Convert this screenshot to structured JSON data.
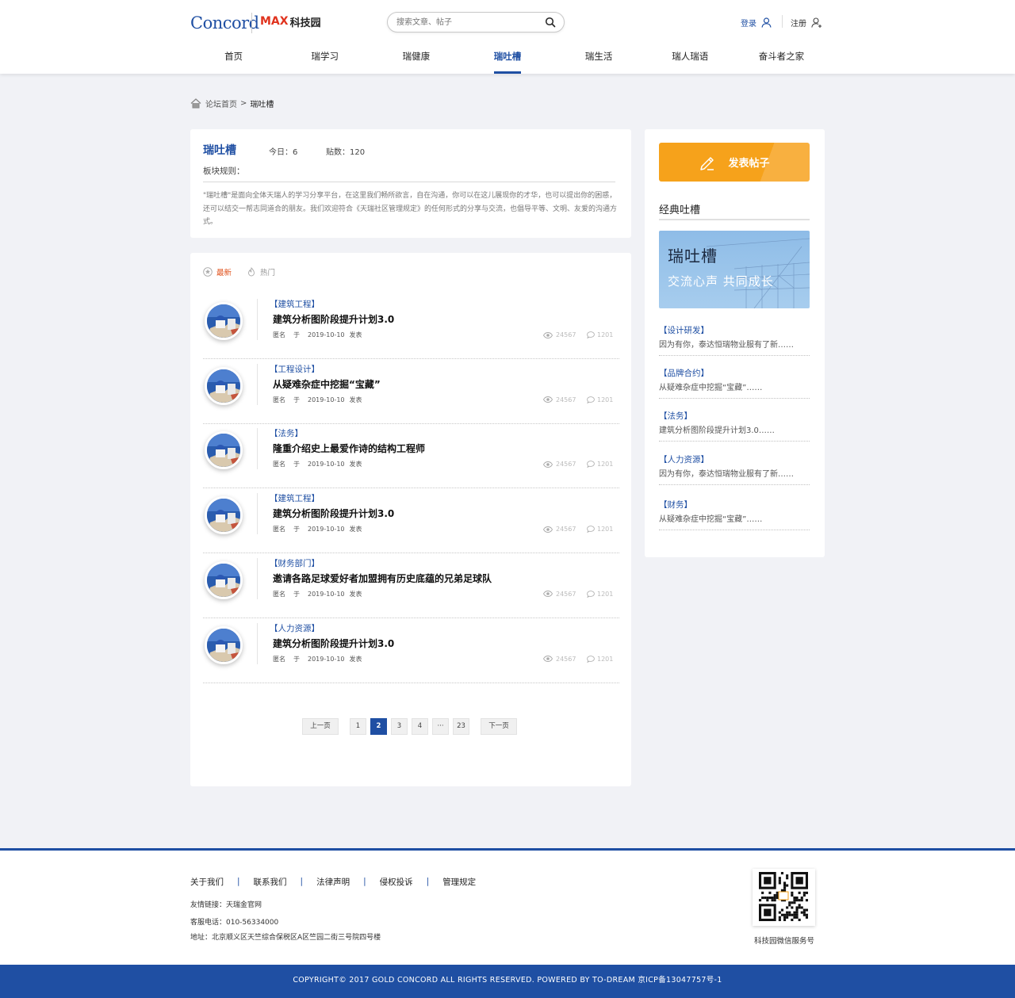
{
  "header": {
    "logo_concord": "Concord",
    "logo_max": "MAX",
    "logo_max_suffix": "科技园",
    "search_placeholder": "搜索文章、帖子",
    "login_label": "登录",
    "register_label": "注册"
  },
  "nav": {
    "items": [
      {
        "label": "首页"
      },
      {
        "label": "瑞学习"
      },
      {
        "label": "瑞健康"
      },
      {
        "label": "瑞吐槽"
      },
      {
        "label": "瑞生活"
      },
      {
        "label": "瑞人瑞语"
      },
      {
        "label": "奋斗者之家"
      }
    ],
    "active": "瑞吐槽"
  },
  "breadcrumb": {
    "home": "论坛首页",
    "separator": ">",
    "current": "瑞吐槽"
  },
  "board": {
    "title": "瑞吐槽",
    "today": "今日：6",
    "posts": "贴数：120",
    "rules_label": "板块规则：",
    "rules_text": "\"瑞吐槽\"是面向全体天瑞人的学习分享平台，在这里我们畅所欲言，自在沟通，你可以在这儿展现你的才华，也可以提出你的困惑，还可以结交一帮志同道合的朋友。我们欢迎符合《天瑞社区管理规定》的任何形式的分享与交流，也倡导平等、文明、友爱的沟通方式。"
  },
  "tabs": {
    "latest": "最新",
    "hot": "热门"
  },
  "posts": [
    {
      "category": "【建筑工程】",
      "title": "建筑分析图阶段提升计划3.0",
      "author": "匿名",
      "prefix": "于",
      "date": "2019-10-10",
      "suffix": "发表",
      "views": "24567",
      "replies": "1201"
    },
    {
      "category": "【工程设计】",
      "title": "从疑难杂症中挖掘“宝藏”",
      "author": "匿名",
      "prefix": "于",
      "date": "2019-10-10",
      "suffix": "发表",
      "views": "24567",
      "replies": "1201"
    },
    {
      "category": "【法务】",
      "title": "隆重介绍史上最爱作诗的结构工程师",
      "author": "匿名",
      "prefix": "于",
      "date": "2019-10-10",
      "suffix": "发表",
      "views": "24567",
      "replies": "1201"
    },
    {
      "category": "【建筑工程】",
      "title": "建筑分析图阶段提升计划3.0",
      "author": "匿名",
      "prefix": "于",
      "date": "2019-10-10",
      "suffix": "发表",
      "views": "24567",
      "replies": "1201"
    },
    {
      "category": "【财务部门】",
      "title": "邀请各路足球爱好者加盟拥有历史底蕴的兄弟足球队",
      "author": "匿名",
      "prefix": "于",
      "date": "2019-10-10",
      "suffix": "发表",
      "views": "24567",
      "replies": "1201"
    },
    {
      "category": "【人力资源】",
      "title": "建筑分析图阶段提升计划3.0",
      "author": "匿名",
      "prefix": "于",
      "date": "2019-10-10",
      "suffix": "发表",
      "views": "24567",
      "replies": "1201"
    }
  ],
  "pagination": {
    "prev": "上一页",
    "pages": [
      "1",
      "2",
      "3",
      "4",
      "···",
      "23"
    ],
    "current": "2",
    "next": "下一页"
  },
  "sidebar": {
    "post_button": "发表帖子",
    "classic_heading": "经典吐槽",
    "banner_title": "瑞吐槽",
    "banner_subtitle": "交流心声 共同成长",
    "classic_items": [
      {
        "category": "【设计研发】",
        "text": "因为有你，泰达恒瑞物业服有了新……"
      },
      {
        "category": "【品牌合约】",
        "text": "从疑难杂症中挖掘“宝藏”……"
      },
      {
        "category": "【法务】",
        "text": "建筑分析图阶段提升计划3.0……"
      },
      {
        "category": "【人力资源】",
        "text": "因为有你，泰达恒瑞物业服有了新……"
      },
      {
        "category": "【财务】",
        "text": "从疑难杂症中挖掘“宝藏”……"
      }
    ]
  },
  "footer": {
    "links": [
      "关于我们",
      "联系我们",
      "法律声明",
      "侵权投诉",
      "管理规定"
    ],
    "link_separator": "|",
    "friend_links": "友情链接：天瑞金官网",
    "phone": "客服电话：010-56334000",
    "address": "地址：北京顺义区天竺综合保税区A区竺园二街三号院四号楼",
    "qr_label": "科技园微信服务号",
    "copyright": "COPYRIGHT© 2017  GOLD CONCORD ALL RIGHTS RESERVED. POWERED BY TO-DREAM    京ICP备13047757号-1"
  },
  "colors": {
    "brand_blue": "#1f4fa3",
    "accent_orange": "#f6a21b",
    "latest_tab": "#e0531e",
    "page_background": "#f1f2f6"
  }
}
